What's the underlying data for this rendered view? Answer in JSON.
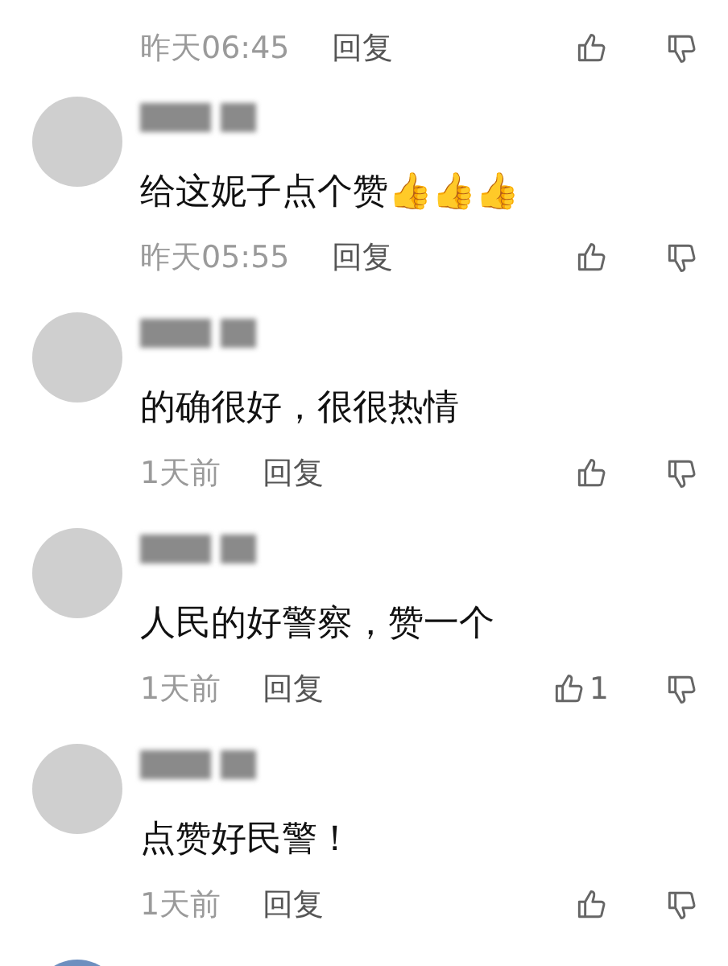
{
  "comments": [
    {
      "time": "昨天06:45",
      "reply": "回复"
    },
    {
      "text": "给这妮子点个赞👍👍👍",
      "time": "昨天05:55",
      "reply": "回复"
    },
    {
      "text": "的确很好，很很热情",
      "time": "1天前",
      "reply": "回复"
    },
    {
      "text": "人民的好警察，赞一个",
      "time": "1天前",
      "reply": "回复",
      "likes": "1"
    },
    {
      "text": "点赞好民警！",
      "time": "1天前",
      "reply": "回复"
    }
  ]
}
